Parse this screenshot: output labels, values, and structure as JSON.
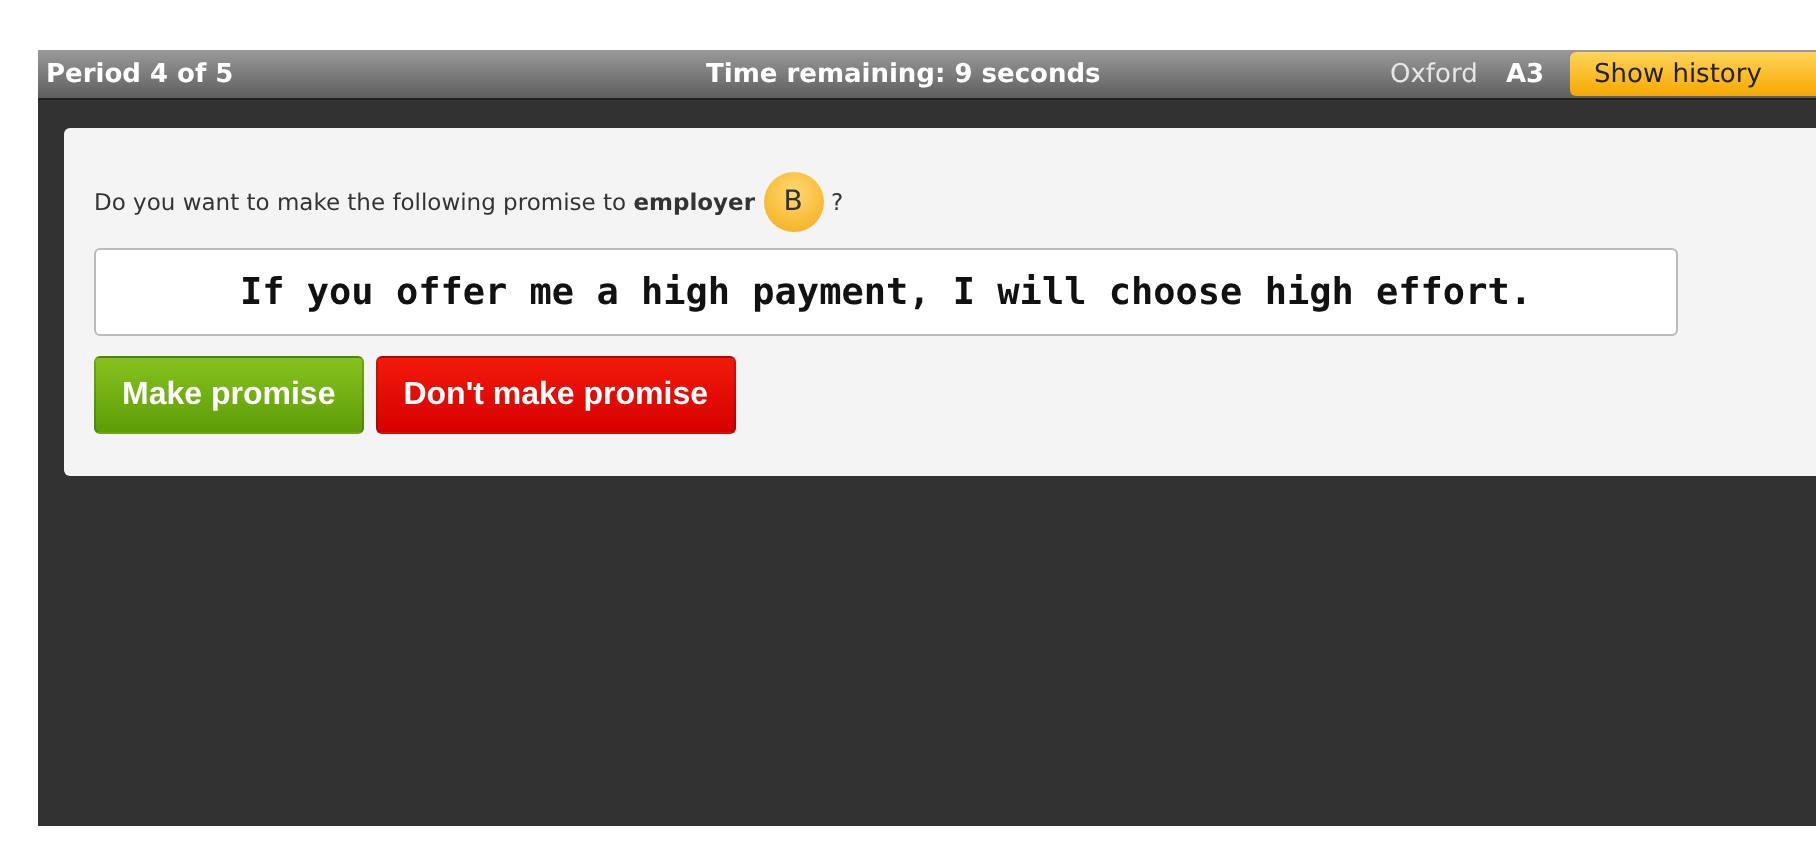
{
  "top_bar": {
    "period": "Period 4 of 5",
    "timer": "Time remaining: 9 seconds",
    "location": "Oxford",
    "player_id": "A3",
    "history_button": "Show history"
  },
  "prompt": {
    "question": "Do you want to make the following promise to **employer**",
    "partner_badge": "B",
    "question_end": "?",
    "promise": "If you offer me a high payment, I will choose high effort."
  },
  "buttons": [
    {
      "label": "Make promise",
      "kind": "accept"
    },
    {
      "label": "Don't make promise",
      "kind": "reject"
    }
  ]
}
